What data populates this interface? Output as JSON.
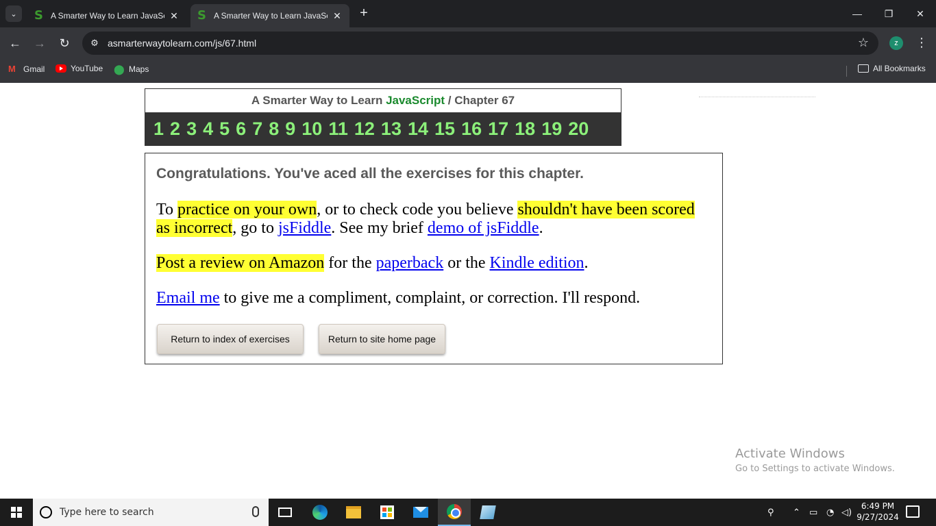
{
  "browser": {
    "tabs": [
      {
        "title": "A Smarter Way to Learn JavaScript",
        "active": false
      },
      {
        "title": "A Smarter Way to Learn JavaScript",
        "active": true
      }
    ],
    "new_tab": "+",
    "url": "asmarterwaytolearn.com/js/67.html",
    "profile_initial": "z",
    "window_controls": {
      "minimize": "—",
      "restore": "❐",
      "close": "✕"
    },
    "bookmarks": [
      {
        "label": "Gmail",
        "icon": "gmail-icon"
      },
      {
        "label": "YouTube",
        "icon": "youtube-icon"
      },
      {
        "label": "Maps",
        "icon": "maps-icon"
      }
    ],
    "all_bookmarks": "All Bookmarks"
  },
  "page": {
    "header": {
      "prefix": "A Smarter Way to Learn ",
      "brand": "JavaScript",
      "separator": " / ",
      "chapter": "Chapter 67"
    },
    "exercise_numbers": [
      "1",
      "2",
      "3",
      "4",
      "5",
      "6",
      "7",
      "8",
      "9",
      "10",
      "11",
      "12",
      "13",
      "14",
      "15",
      "16",
      "17",
      "18",
      "19",
      "20"
    ],
    "congrats": "Congratulations. You've aced all the exercises for this chapter.",
    "p1": {
      "t1": "To ",
      "h1": "practice on your own",
      "t2": ", or to check code you believe ",
      "h2": "shouldn't have been scored as incorrect",
      "t3": ", go to ",
      "l1": "jsFiddle",
      "t4": ". See my brief ",
      "l2": "demo of jsFiddle",
      "t5": "."
    },
    "p2": {
      "h1": "Post a review on Amazon",
      "t1": " for the ",
      "l1": "paperback",
      "t2": " or the ",
      "l2": "Kindle edition",
      "t3": "."
    },
    "p3": {
      "l1": "Email me",
      "t1": " to give me a compliment, complaint, or correction. I'll respond."
    },
    "buttons": {
      "index": "Return to index of exercises",
      "home": "Return to site home page"
    }
  },
  "watermark": {
    "line1": "Activate Windows",
    "line2": "Go to Settings to activate Windows."
  },
  "taskbar": {
    "search_placeholder": "Type here to search",
    "time": "6:49 PM",
    "date": "9/27/2024"
  }
}
